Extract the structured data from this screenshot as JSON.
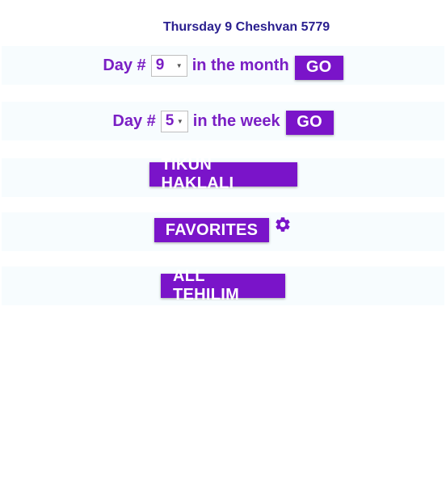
{
  "header": {
    "date_label": "Thursday 9 Cheshvan 5779"
  },
  "month_row": {
    "prefix": "Day #",
    "selected_day": "9",
    "suffix": "in the month",
    "go_label": "GO"
  },
  "week_row": {
    "prefix": "Day #",
    "selected_day": "5",
    "suffix": "in the week",
    "go_label": "GO"
  },
  "buttons": {
    "tikun_label": "TIKUN HAKLALI",
    "favorites_label": "FAVORITES",
    "settings_icon": "gear-icon",
    "all_tehilim_label": "ALL TEHILIM"
  },
  "colors": {
    "accent": "#7a14c9",
    "label_text": "#7a1fc4",
    "date_text": "#2a1f8f",
    "row_background": "#f7fcfe"
  }
}
